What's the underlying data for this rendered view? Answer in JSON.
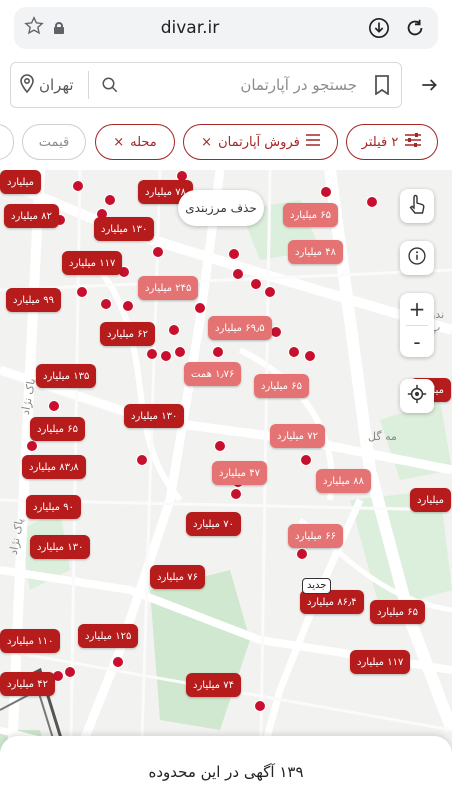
{
  "browser": {
    "url": "divar.ir",
    "star_icon": "star-outline-icon",
    "lock_icon": "lock-icon",
    "download_icon": "download-icon",
    "reload_icon": "reload-icon"
  },
  "search": {
    "placeholder": "جستجو در آپارتمان",
    "city": "تهران",
    "bookmark_icon": "bookmark-icon",
    "search_icon": "search-icon",
    "location_icon": "location-pin-icon",
    "back_icon": "arrow-right-icon"
  },
  "filters": {
    "filter_count_label": "۲ فیلتر",
    "category_label": "فروش آپارتمان",
    "neighborhood_label": "محله",
    "price_label": "قیمت",
    "remove_symbol": "×"
  },
  "map": {
    "remove_boundary_label": "حذف مرزبندی",
    "new_badge": "جدید",
    "streets": [
      "پاک نژاد",
      "پاک نژاد",
      "مه گل",
      "ندو پ"
    ],
    "pins": [
      {
        "label": "۷۸ میلیارد",
        "tone": "dark"
      },
      {
        "label": "۸۲ میلیارد",
        "tone": "dark"
      },
      {
        "label": "۱۳۰ میلیارد",
        "tone": "dark"
      },
      {
        "label": "۶۵ میلیارد",
        "tone": "light"
      },
      {
        "label": "۴۸ میلیارد",
        "tone": "light"
      },
      {
        "label": "۱۱۷ میلیارد",
        "tone": "dark"
      },
      {
        "label": "۲۴۵ میلیارد",
        "tone": "light"
      },
      {
        "label": "۹۹ میلیارد",
        "tone": "dark"
      },
      {
        "label": "۶۹٫۵ میلیارد",
        "tone": "light"
      },
      {
        "label": "۶۲ میلیارد",
        "tone": "dark"
      },
      {
        "label": "۱۳۵ میلیارد",
        "tone": "dark"
      },
      {
        "label": "۱٫۷۶ همت",
        "tone": "light"
      },
      {
        "label": "۶۵ میلیارد",
        "tone": "light"
      },
      {
        "label": "۱۳۰ میلیارد",
        "tone": "dark"
      },
      {
        "label": "۶۵ میلیارد",
        "tone": "dark"
      },
      {
        "label": "۷۲ میلیارد",
        "tone": "light"
      },
      {
        "label": "۸۳٫۸ میلیارد",
        "tone": "dark"
      },
      {
        "label": "۴۷ میلیارد",
        "tone": "light"
      },
      {
        "label": "۸۸ میلیارد",
        "tone": "light"
      },
      {
        "label": "۹۰ میلیارد",
        "tone": "dark"
      },
      {
        "label": "۷۰ میلیارد",
        "tone": "dark"
      },
      {
        "label": "۶۶ میلیارد",
        "tone": "light"
      },
      {
        "label": "۱۳۰ میلیارد",
        "tone": "dark"
      },
      {
        "label": "۷۶ میلیارد",
        "tone": "dark"
      },
      {
        "label": "۸۶٫۴ میلیارد",
        "tone": "dark"
      },
      {
        "label": "۶۵ میلیارد",
        "tone": "dark"
      },
      {
        "label": "۱۲۵ میلیارد",
        "tone": "dark"
      },
      {
        "label": "۱۱۰ میلیارد",
        "tone": "dark"
      },
      {
        "label": "۱۱۷ میلیارد",
        "tone": "dark"
      },
      {
        "label": "۷۴ میلیارد",
        "tone": "dark"
      },
      {
        "label": "۴۲ میلیارد",
        "tone": "dark"
      },
      {
        "label": "میلیارد",
        "tone": "dark"
      },
      {
        "label": "میلیارد",
        "tone": "dark"
      },
      {
        "label": "میلیارد",
        "tone": "dark"
      }
    ],
    "controls": {
      "select_icon": "hand-pointer-icon",
      "info_icon": "info-icon",
      "zoom_in": "+",
      "zoom_out": "-",
      "locate_icon": "locate-crosshair-icon"
    }
  },
  "bottom_sheet": {
    "count_text": "۱۳۹ آگهی در این محدوده"
  }
}
